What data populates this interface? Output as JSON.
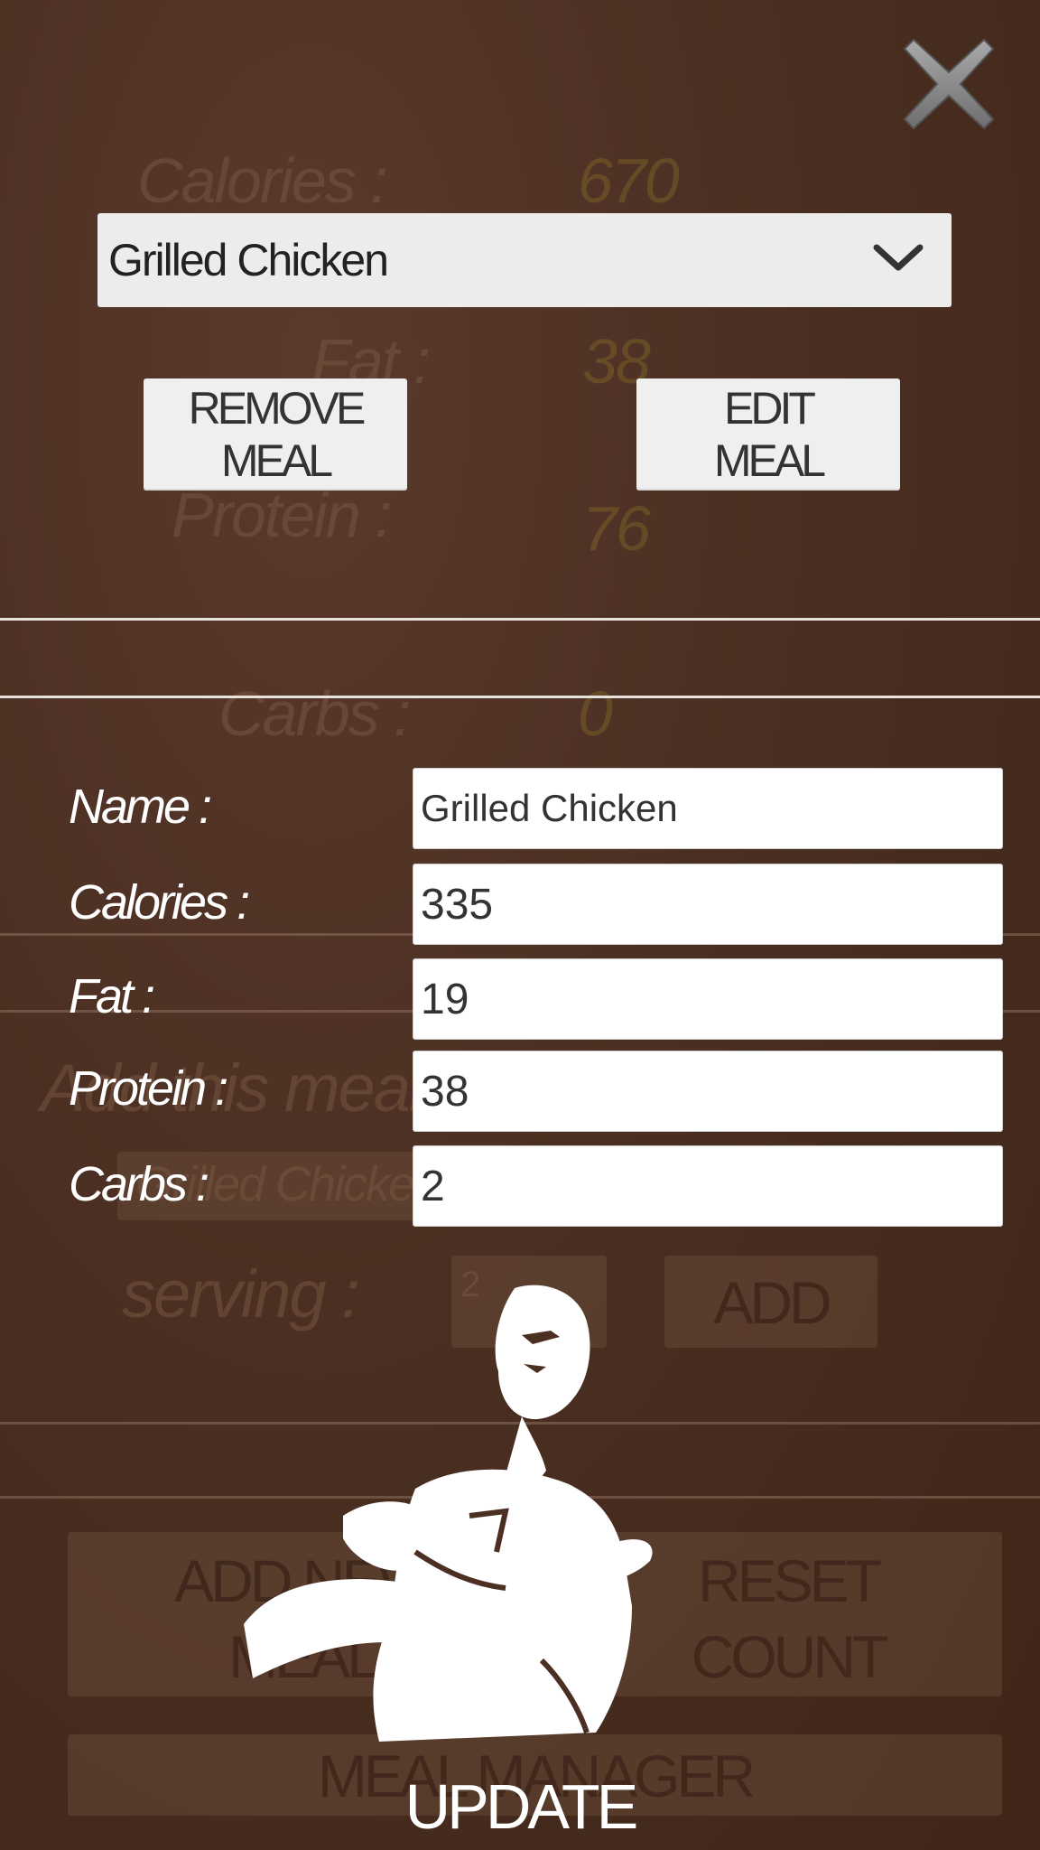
{
  "background_text": {
    "calories_label": "Calories :",
    "calories_value": "670",
    "fat_label": "Fat :",
    "fat_value": "38",
    "protein_label": "Protein :",
    "protein_value": "76",
    "carbs_label": "Carbs :",
    "carbs_value": "0",
    "add_meal_label": "Add this meal",
    "meal_select_value": "Grilled Chicken",
    "serving_label": "serving :",
    "serving_value": "2",
    "add_button": "ADD",
    "add_new_meal_button": "ADD NEW\nMEAL",
    "reset_count_button": "RESET\nCOUNT",
    "meal_manager_button": "MEAL MANAGER"
  },
  "dialog": {
    "close_icon": "close-x-icon",
    "dropdown": {
      "selected": "Grilled Chicken",
      "icon": "chevron-down-icon"
    },
    "remove_meal_button": "REMOVE\nMEAL",
    "edit_meal_button": "EDIT\nMEAL",
    "form": {
      "name_label": "Name :",
      "name_value": "Grilled Chicken",
      "calories_label": "Calories :",
      "calories_value": "335",
      "fat_label": "Fat :",
      "fat_value": "19",
      "protein_label": "Protein :",
      "protein_value": "38",
      "carbs_label": "Carbs :",
      "carbs_value": "2"
    },
    "update_button": "UPDATE"
  },
  "colors": {
    "background": "#4a2f22",
    "input_bg": "#ffffff",
    "button_bg": "#efefef",
    "label_text": "#ffffff"
  }
}
